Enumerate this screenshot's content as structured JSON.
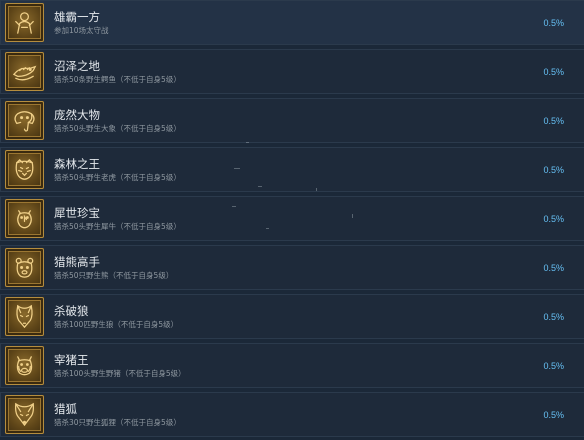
{
  "achievements": [
    {
      "title": "雄霸一方",
      "desc": "参加10场太守战",
      "percent": "0.5%",
      "icon": "warrior-icon"
    },
    {
      "title": "沼泽之地",
      "desc": "猎杀50条野生鳄鱼（不低于自身5级）",
      "percent": "0.5%",
      "icon": "crocodile-icon"
    },
    {
      "title": "庞然大物",
      "desc": "猎杀50头野生大象（不低于自身5级）",
      "percent": "0.5%",
      "icon": "elephant-icon"
    },
    {
      "title": "森林之王",
      "desc": "猎杀50头野生老虎（不低于自身5级）",
      "percent": "0.5%",
      "icon": "tiger-icon"
    },
    {
      "title": "犀世珍宝",
      "desc": "猎杀50头野生犀牛（不低于自身5级）",
      "percent": "0.5%",
      "icon": "rhino-icon"
    },
    {
      "title": "猎熊高手",
      "desc": "猎杀50只野生熊（不低于自身5级）",
      "percent": "0.5%",
      "icon": "bear-icon"
    },
    {
      "title": "杀破狼",
      "desc": "猎杀100匹野生狼（不低于自身5级）",
      "percent": "0.5%",
      "icon": "wolf-icon"
    },
    {
      "title": "宰猪王",
      "desc": "猎杀100头野生野猪（不低于自身5级）",
      "percent": "0.5%",
      "icon": "boar-icon"
    },
    {
      "title": "猎狐",
      "desc": "猎杀30只野生狐狸（不低于自身5级）",
      "percent": "0.5%",
      "icon": "fox-icon"
    }
  ],
  "colors": {
    "background": "#1b2838",
    "row": "#1e2a3a",
    "percent": "#66c0f4",
    "badge_gold": "#b58d3e"
  }
}
